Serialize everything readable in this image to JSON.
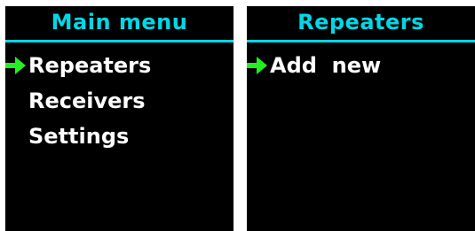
{
  "panels": [
    {
      "title": "Main menu",
      "items": [
        {
          "label": "Repeaters",
          "selected": true
        },
        {
          "label": "Receivers",
          "selected": false
        },
        {
          "label": "Settings",
          "selected": false
        }
      ]
    },
    {
      "title": "Repeaters",
      "items": [
        {
          "label": "Add  new",
          "selected": true
        }
      ]
    }
  ],
  "colors": {
    "title": "#00d8e8",
    "pointer": "#22ee22",
    "text": "#ffffff",
    "background": "#000000"
  },
  "icons": {
    "selection_pointer": "arrow-right-icon"
  }
}
